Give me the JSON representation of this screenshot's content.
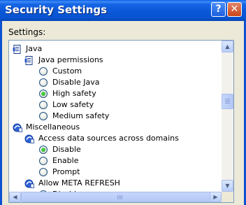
{
  "window": {
    "title": "Security Settings",
    "help_label": "?",
    "close_label": "✕"
  },
  "settings_label": "Settings:",
  "tree": [
    {
      "type": "group",
      "label": "Java"
    },
    {
      "type": "subgroup",
      "label": "Java permissions"
    },
    {
      "type": "option",
      "label": "Custom",
      "checked": false
    },
    {
      "type": "option",
      "label": "Disable Java",
      "checked": false
    },
    {
      "type": "option",
      "label": "High safety",
      "checked": true
    },
    {
      "type": "option",
      "label": "Low safety",
      "checked": false
    },
    {
      "type": "option",
      "label": "Medium safety",
      "checked": false
    },
    {
      "type": "group",
      "label": "Miscellaneous"
    },
    {
      "type": "subgroup",
      "label": "Access data sources across domains"
    },
    {
      "type": "option",
      "label": "Disable",
      "checked": true
    },
    {
      "type": "option",
      "label": "Enable",
      "checked": false
    },
    {
      "type": "option",
      "label": "Prompt",
      "checked": false
    },
    {
      "type": "subgroup",
      "label": "Allow META REFRESH"
    },
    {
      "type": "option",
      "label": "Disable",
      "checked": false
    }
  ],
  "scrollbar": {
    "up_glyph": "▲",
    "down_glyph": "▼",
    "left_glyph": "◀",
    "right_glyph": "▶"
  }
}
